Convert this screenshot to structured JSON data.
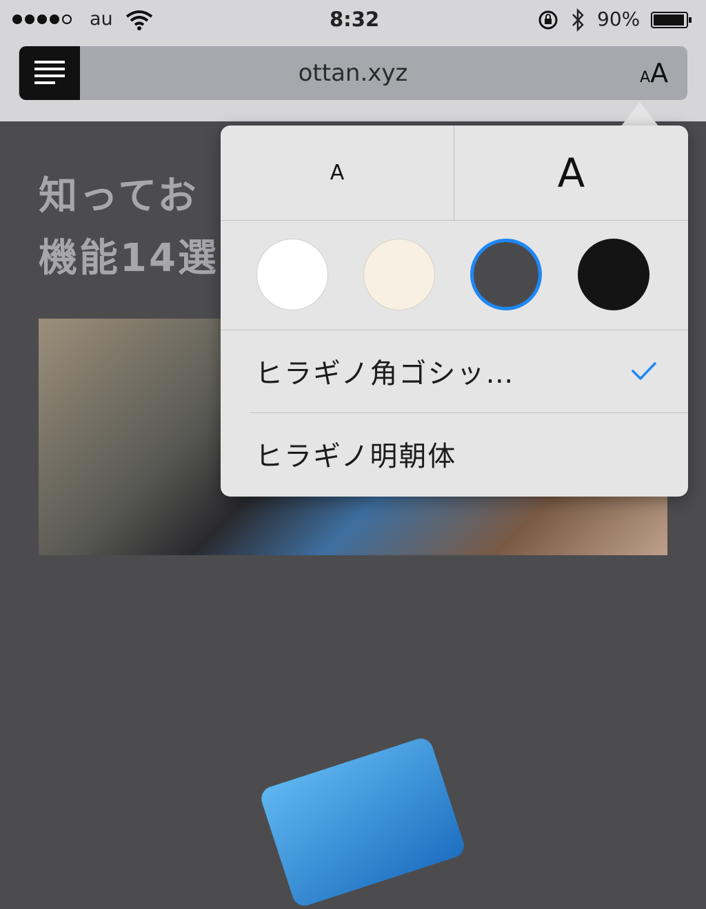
{
  "status_bar": {
    "carrier": "au",
    "time": "8:32",
    "battery_percent": "90%",
    "signal_bars": 4,
    "signal_total": 5
  },
  "address_bar": {
    "url": "ottan.xyz",
    "text_size_small": "A",
    "text_size_large": "A"
  },
  "page": {
    "title_line1": "知ってお",
    "title_line2": "機能14選"
  },
  "reader_popover": {
    "smaller_text_label": "A",
    "larger_text_label": "A",
    "themes": [
      {
        "name": "white",
        "color": "#ffffff"
      },
      {
        "name": "sepia",
        "color": "#f7f0e3"
      },
      {
        "name": "gray",
        "color": "#4a4a4d",
        "selected": true
      },
      {
        "name": "night",
        "color": "#141414"
      }
    ],
    "selection_color": "#1e88f5",
    "fonts": [
      {
        "label": "ヒラギノ角ゴシッ…",
        "selected": true
      },
      {
        "label": "ヒラギノ明朝体",
        "selected": false
      }
    ]
  }
}
